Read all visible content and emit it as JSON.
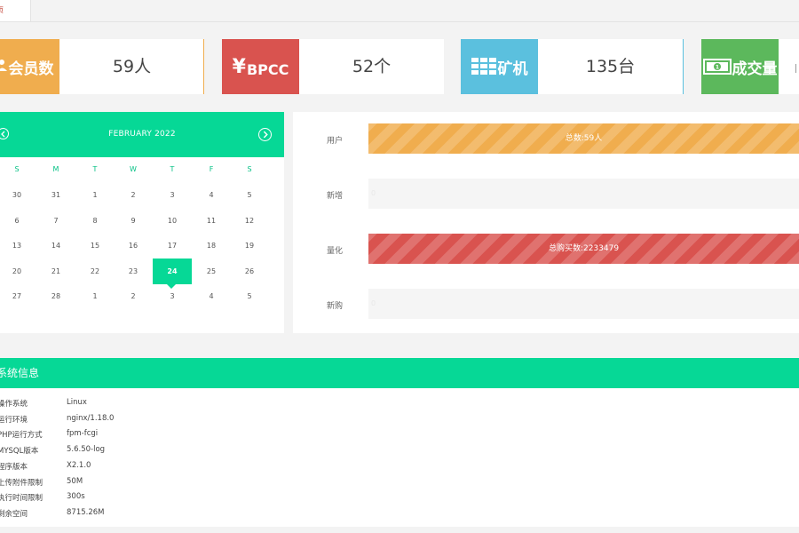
{
  "tab": {
    "label": "页"
  },
  "stats": [
    {
      "icon": "users-icon",
      "label": "会员数",
      "value": "59人",
      "color": "#f0ad4e"
    },
    {
      "icon": "yen-icon",
      "label": "BPCC",
      "symbol": "¥",
      "value": "52个",
      "color": "#d9534f"
    },
    {
      "icon": "grid-icon",
      "label": "矿机",
      "value": "135台",
      "color": "#5bc0de"
    },
    {
      "icon": "cash-icon",
      "label": "成交量",
      "value": "",
      "color": "#5cb85c"
    }
  ],
  "calendar": {
    "title": "FEBRUARY 2022",
    "weekdays": [
      "S",
      "M",
      "T",
      "W",
      "T",
      "F",
      "S"
    ],
    "weeks": [
      [
        "30",
        "31",
        "1",
        "2",
        "3",
        "4",
        "5"
      ],
      [
        "6",
        "7",
        "8",
        "9",
        "10",
        "11",
        "12"
      ],
      [
        "13",
        "14",
        "15",
        "16",
        "17",
        "18",
        "19"
      ],
      [
        "20",
        "21",
        "22",
        "23",
        "24",
        "25",
        "26"
      ],
      [
        "27",
        "28",
        "1",
        "2",
        "3",
        "4",
        "5"
      ]
    ],
    "selected": "24",
    "accent": "#06d896"
  },
  "progress": [
    {
      "label": "用户",
      "text": "总数:59人",
      "percent": 100,
      "color": "orange"
    },
    {
      "label": "新增",
      "text": "0",
      "percent": 0,
      "color": "none"
    },
    {
      "label": "量化",
      "text": "总购买数:2233479",
      "percent": 100,
      "color": "red"
    },
    {
      "label": "新购",
      "text": "0",
      "percent": 0,
      "color": "none"
    }
  ],
  "system": {
    "title": "系统信息",
    "rows": [
      {
        "key": "操作系统",
        "value": "Linux"
      },
      {
        "key": "运行环境",
        "value": "nginx/1.18.0"
      },
      {
        "key": "PHP运行方式",
        "value": "fpm-fcgi"
      },
      {
        "key": "MYSQL版本",
        "value": "5.6.50-log"
      },
      {
        "key": "程序版本",
        "value": "X2.1.0"
      },
      {
        "key": "上传附件限制",
        "value": "50M"
      },
      {
        "key": "执行时间限制",
        "value": "300s"
      },
      {
        "key": "剩余空间",
        "value": "8715.26M"
      }
    ]
  }
}
